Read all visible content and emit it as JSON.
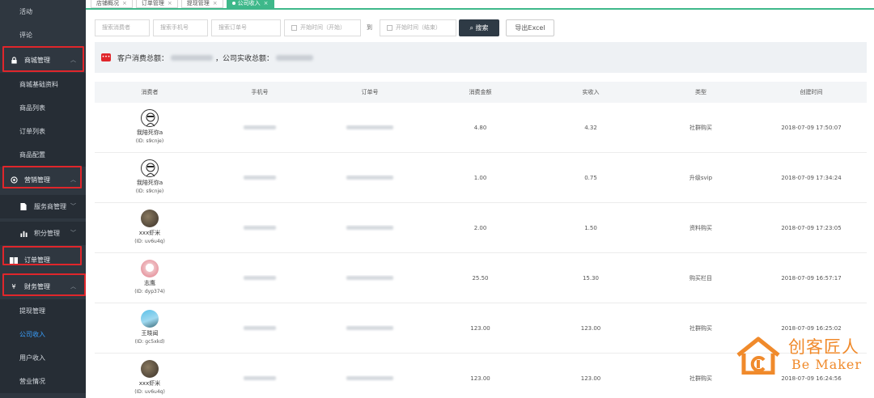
{
  "sidebar": {
    "items": [
      {
        "label": "活动"
      },
      {
        "label": "评论"
      },
      {
        "label": "商城管理"
      },
      {
        "label": "商城基础资料"
      },
      {
        "label": "商品列表"
      },
      {
        "label": "订单列表"
      },
      {
        "label": "商品配置"
      },
      {
        "label": "营销管理"
      },
      {
        "label": "服务商管理"
      },
      {
        "label": "积分管理"
      },
      {
        "label": "订单管理"
      },
      {
        "label": "财务管理"
      },
      {
        "label": "提现管理"
      },
      {
        "label": "公司收入"
      },
      {
        "label": "用户收入"
      },
      {
        "label": "营业情况"
      }
    ]
  },
  "tabs": [
    {
      "label": "店铺概况"
    },
    {
      "label": "订单管理"
    },
    {
      "label": "提现管理"
    },
    {
      "label": "公司收入"
    }
  ],
  "filters": {
    "consumer_placeholder": "搜索消费者",
    "phone_placeholder": "搜索手机号",
    "order_placeholder": "搜索订单号",
    "start_placeholder": "开始时间（开始）",
    "to_label": "到",
    "end_placeholder": "开始时间（结束）",
    "search_label": "搜索",
    "export_label": "导出Excel"
  },
  "summary": {
    "consumer_total_label": "客户消费总额：",
    "company_total_label": "，公司实收总额："
  },
  "table": {
    "headers": [
      "消费者",
      "手机号",
      "订单号",
      "消费金额",
      "实收入",
      "类型",
      "创建时间"
    ],
    "rows": [
      {
        "name": "我陪死你a",
        "id": "(ID: s9cnje)",
        "amount": "4.80",
        "income": "4.32",
        "type": "社群购买",
        "time": "2018-07-09 17:50:07"
      },
      {
        "name": "我陪死你a",
        "id": "(ID: s9cnje)",
        "amount": "1.00",
        "income": "0.75",
        "type": "升级svip",
        "time": "2018-07-09 17:34:24"
      },
      {
        "name": "xxx虾米",
        "id": "(ID: uv6u4q)",
        "amount": "2.00",
        "income": "1.50",
        "type": "资料购买",
        "time": "2018-07-09 17:23:05"
      },
      {
        "name": "志鹰",
        "id": "(ID: dyp374)",
        "amount": "25.50",
        "income": "15.30",
        "type": "购买栏目",
        "time": "2018-07-09 16:57:17"
      },
      {
        "name": "王晓闻",
        "id": "(ID: gc5xkd)",
        "amount": "123.00",
        "income": "123.00",
        "type": "社群购买",
        "time": "2018-07-09 16:25:02"
      },
      {
        "name": "xxx虾米",
        "id": "(ID: uv6u4q)",
        "amount": "123.00",
        "income": "123.00",
        "type": "社群购买",
        "time": "2018-07-09 16:24:56"
      }
    ]
  },
  "logo": {
    "cn": "创客匠人",
    "en": "Be Maker"
  },
  "colors": {
    "sidebar_bg": "#2f3740",
    "accent_green": "#3eb88a",
    "highlight_red": "#e0262b",
    "link_blue": "#3aa1ff",
    "logo_orange": "#f08a2b"
  }
}
